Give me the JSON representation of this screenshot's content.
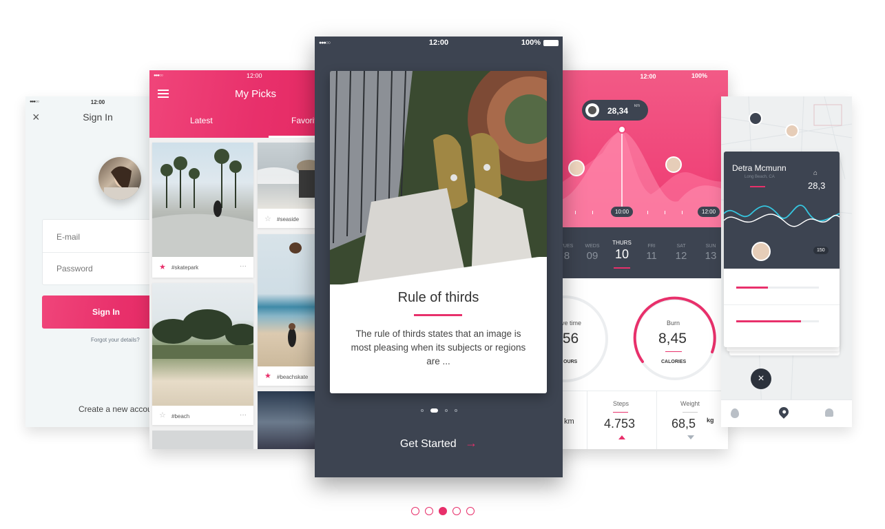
{
  "status_bar": {
    "time": "12:00",
    "battery": "100%",
    "signal": "●●●○○"
  },
  "signin": {
    "title": "Sign In",
    "email_placeholder": "E-mail",
    "password_placeholder": "Password",
    "button": "Sign In",
    "forgot": "Forgot your details?",
    "create": "Create a new accou"
  },
  "picks": {
    "title": "My Picks",
    "tabs": [
      "Latest",
      "Favorit"
    ],
    "cards": [
      {
        "tag": "#skatepark",
        "starred": true
      },
      {
        "tag": "#seaside",
        "starred": false
      },
      {
        "tag": "#beach",
        "starred": false
      },
      {
        "tag": "#beachskate",
        "starred": true
      }
    ],
    "more": "···"
  },
  "onboarding": {
    "card_title": "Rule of thirds",
    "card_body": "The rule of thirds states that an image is most pleasing when its subjects or regions are ...",
    "cta": "Get Started",
    "arrow": "→",
    "page_dots": 4,
    "active_dot": 1
  },
  "activity": {
    "distance_bubble": "28,34",
    "distance_unit": "km",
    "time_left": "10:00",
    "time_right": "12:00",
    "days": [
      {
        "name": "TUES",
        "num": "8"
      },
      {
        "name": "WEDS",
        "num": "09"
      },
      {
        "name": "THURS",
        "num": "10"
      },
      {
        "name": "FRI",
        "num": "11"
      },
      {
        "name": "SAT",
        "num": "12"
      },
      {
        "name": "SUN",
        "num": "13"
      }
    ],
    "active_day": 2,
    "active_time": {
      "label": "ve time",
      "value": ":56",
      "unit": "OURS"
    },
    "burn": {
      "label": "Burn",
      "value": "8,45",
      "unit": "CALORIES"
    },
    "km_unit": "km",
    "steps": {
      "label": "Steps",
      "value": "4.753"
    },
    "weight": {
      "label": "Weight",
      "value": "68,5",
      "unit": "kg"
    }
  },
  "map": {
    "name": "Detra Mcmunn",
    "location": "Long Beach, CA",
    "stat": "28,3",
    "badge": "150",
    "close": "×",
    "bars": [
      0.38,
      0.78
    ]
  },
  "carousel": {
    "count": 5,
    "active": 2
  },
  "colors": {
    "accent": "#e8306b",
    "dark": "#3d4451",
    "pink_light": "#f0457a"
  }
}
